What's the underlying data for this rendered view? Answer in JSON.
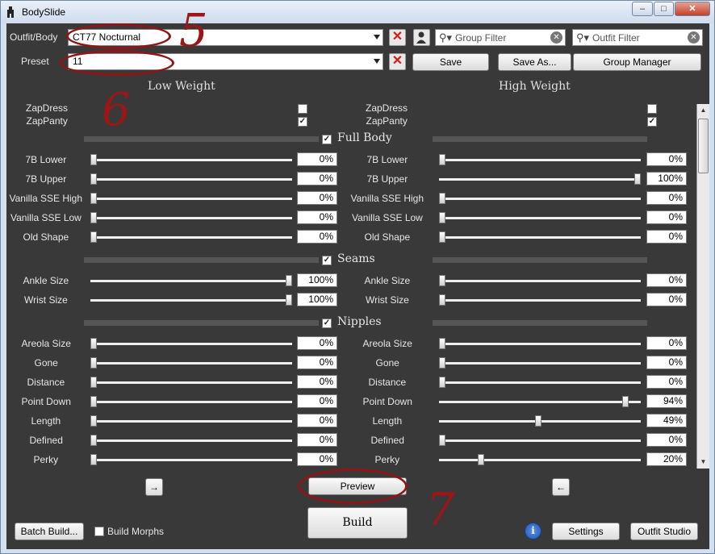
{
  "window": {
    "title": "BodySlide",
    "controls": [
      "–",
      "□",
      "✕"
    ]
  },
  "toolbar": {
    "outfit_label": "Outfit/Body",
    "outfit_value": "CT77 Nocturnal",
    "preset_label": "Preset",
    "preset_value": "11",
    "group_filter_placeholder": "Group Filter",
    "outfit_filter_placeholder": "Outfit Filter",
    "save_label": "Save",
    "save_as_label": "Save As...",
    "group_manager_label": "Group Manager"
  },
  "columns": {
    "low": "Low Weight",
    "high": "High Weight"
  },
  "zaps": [
    {
      "label": "ZapDress",
      "low_checked": false,
      "high_checked": false
    },
    {
      "label": "ZapPanty",
      "low_checked": true,
      "high_checked": true
    }
  ],
  "groups": [
    {
      "name": "Full Body",
      "sliders": [
        {
          "label": "7B Lower",
          "low": "0%",
          "high": "0%",
          "low_frac": 0.0,
          "high_frac": 0.0
        },
        {
          "label": "7B Upper",
          "low": "0%",
          "high": "100%",
          "low_frac": 0.0,
          "high_frac": 1.0
        },
        {
          "label": "Vanilla SSE High",
          "low": "0%",
          "high": "0%",
          "low_frac": 0.0,
          "high_frac": 0.0
        },
        {
          "label": "Vanilla SSE Low",
          "low": "0%",
          "high": "0%",
          "low_frac": 0.0,
          "high_frac": 0.0
        },
        {
          "label": "Old Shape",
          "low": "0%",
          "high": "0%",
          "low_frac": 0.0,
          "high_frac": 0.0
        }
      ]
    },
    {
      "name": "Seams",
      "sliders": [
        {
          "label": "Ankle Size",
          "low": "100%",
          "high": "0%",
          "low_frac": 1.0,
          "high_frac": 0.0
        },
        {
          "label": "Wrist Size",
          "low": "100%",
          "high": "0%",
          "low_frac": 1.0,
          "high_frac": 0.0
        }
      ]
    },
    {
      "name": "Nipples",
      "sliders": [
        {
          "label": "Areola Size",
          "low": "0%",
          "high": "0%",
          "low_frac": 0.0,
          "high_frac": 0.0
        },
        {
          "label": "Gone",
          "low": "0%",
          "high": "0%",
          "low_frac": 0.0,
          "high_frac": 0.0
        },
        {
          "label": "Distance",
          "low": "0%",
          "high": "0%",
          "low_frac": 0.0,
          "high_frac": 0.0
        },
        {
          "label": "Point Down",
          "low": "0%",
          "high": "94%",
          "low_frac": 0.0,
          "high_frac": 0.94
        },
        {
          "label": "Length",
          "low": "0%",
          "high": "49%",
          "low_frac": 0.0,
          "high_frac": 0.49
        },
        {
          "label": "Defined",
          "low": "0%",
          "high": "0%",
          "low_frac": 0.0,
          "high_frac": 0.0
        },
        {
          "label": "Perky",
          "low": "0%",
          "high": "20%",
          "low_frac": 0.0,
          "high_frac": 0.2
        }
      ]
    }
  ],
  "bottom": {
    "left_arrow": "→",
    "right_arrow": "←",
    "preview_label": "Preview",
    "build_label": "Build",
    "batch_build_label": "Batch Build...",
    "build_morphs_label": "Build Morphs",
    "build_morphs_checked": false,
    "settings_label": "Settings",
    "outfit_studio_label": "Outfit Studio",
    "info_glyph": "i"
  },
  "annotations": [
    "5",
    "6",
    "7"
  ],
  "colors": {
    "panel_bg": "#393939",
    "annotation_red": "#9b1616"
  }
}
